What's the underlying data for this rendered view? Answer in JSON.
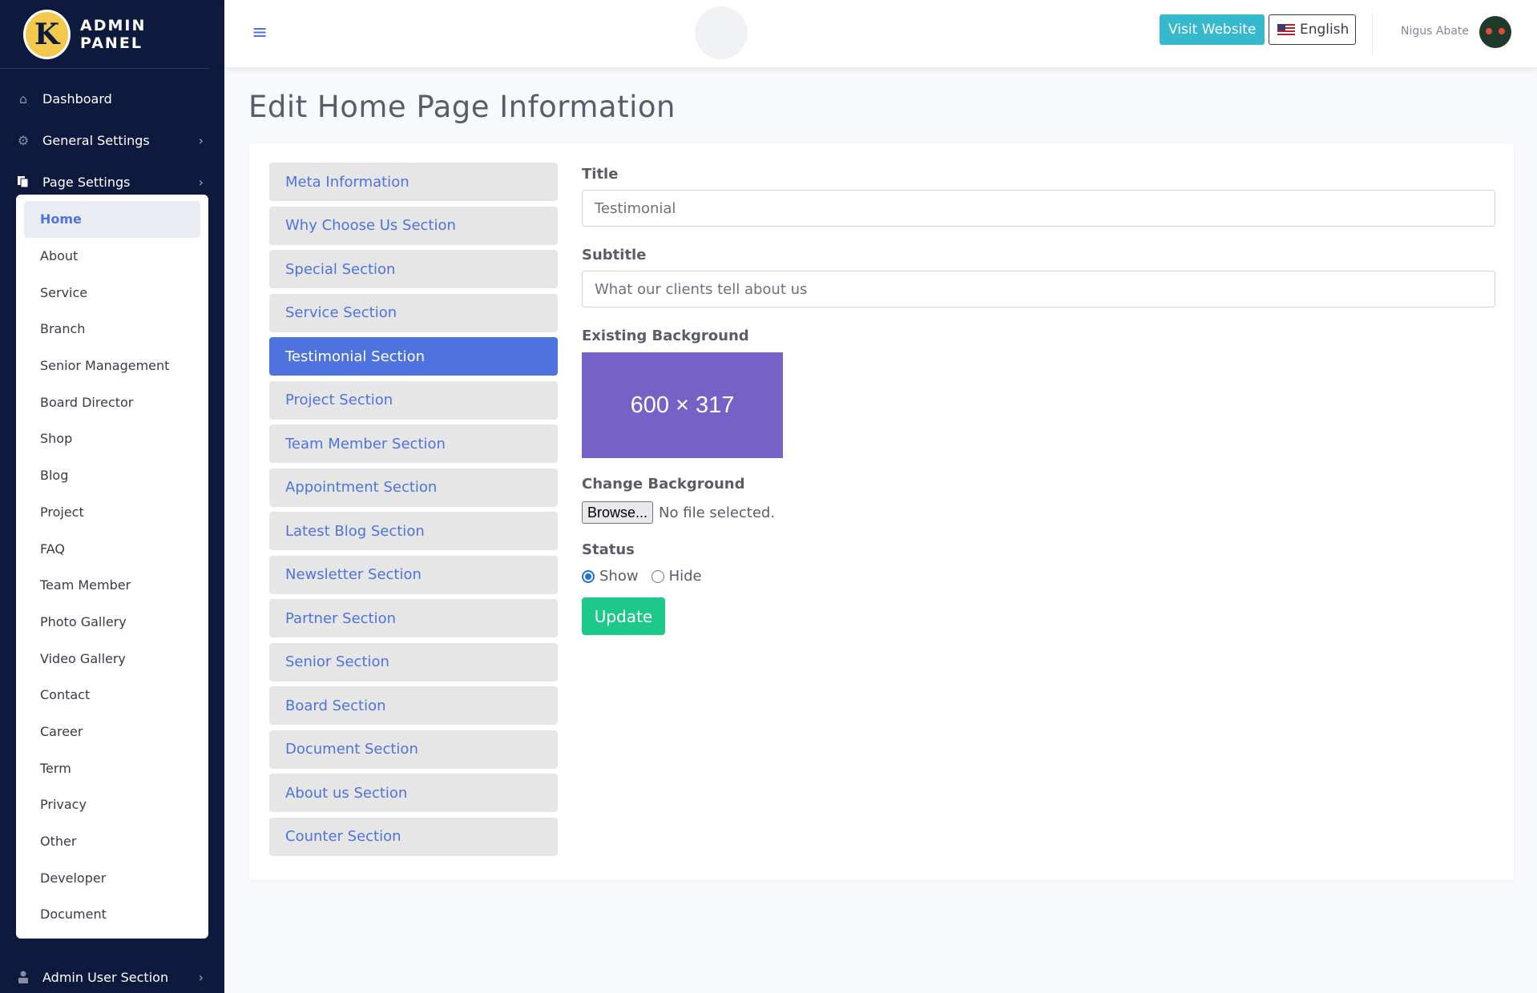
{
  "sidebar": {
    "brand_letter": "K",
    "brand_text": "ADMIN PANEL",
    "nav": [
      {
        "label": "Dashboard",
        "icon": "home-icon",
        "has_chevron": false
      },
      {
        "label": "General Settings",
        "icon": "gear-icon",
        "has_chevron": true
      },
      {
        "label": "Page Settings",
        "icon": "copy-icon",
        "has_chevron": true
      }
    ],
    "submenu": [
      "Home",
      "About",
      "Service",
      "Branch",
      "Senior Management",
      "Board Director",
      "Shop",
      "Blog",
      "Project",
      "FAQ",
      "Team Member",
      "Photo Gallery",
      "Video Gallery",
      "Contact",
      "Career",
      "Term",
      "Privacy",
      "Other",
      "Developer",
      "Document"
    ],
    "submenu_active": "Home",
    "bottom_nav": {
      "label": "Admin User Section",
      "icon": "user-lock-icon"
    }
  },
  "topbar": {
    "menu_icon": "bars-icon",
    "visit_label": "Visit Website",
    "language_label": "English",
    "user_name": "Nigus Abate"
  },
  "page": {
    "title": "Edit Home Page Information"
  },
  "tabs": [
    "Meta Information",
    "Why Choose Us Section",
    "Special Section",
    "Service Section",
    "Testimonial Section",
    "Project Section",
    "Team Member Section",
    "Appointment Section",
    "Latest Blog Section",
    "Newsletter Section",
    "Partner Section",
    "Senior Section",
    "Board Section",
    "Document Section",
    "About us Section",
    "Counter Section"
  ],
  "tab_active": "Testimonial Section",
  "form": {
    "title_label": "Title",
    "title_value": "Testimonial",
    "subtitle_label": "Subtitle",
    "subtitle_value": "What our clients tell about us",
    "existing_bg_label": "Existing Background",
    "bg_placeholder_text": "600 × 317",
    "change_bg_label": "Change Background",
    "browse_label": "Browse...",
    "file_status": "No file selected.",
    "status_label": "Status",
    "status_options": [
      "Show",
      "Hide"
    ],
    "status_selected": "Show",
    "update_label": "Update"
  },
  "colors": {
    "sidebar_bg": "#0e1a3d",
    "primary": "#4e73df",
    "info": "#36b9cc",
    "success": "#1cc88a",
    "preview_bg": "#7662c6"
  }
}
